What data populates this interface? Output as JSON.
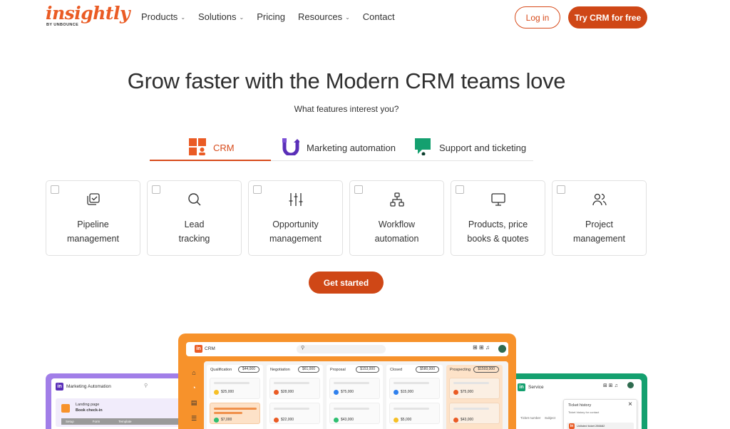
{
  "header": {
    "logo_text": "insightly",
    "logo_sub": "BY UNBOUNCE",
    "nav": [
      {
        "label": "Products",
        "dropdown": true
      },
      {
        "label": "Solutions",
        "dropdown": true
      },
      {
        "label": "Pricing",
        "dropdown": false
      },
      {
        "label": "Resources",
        "dropdown": true
      },
      {
        "label": "Contact",
        "dropdown": false
      }
    ],
    "login_label": "Log in",
    "try_label": "Try CRM for free"
  },
  "hero": {
    "title": "Grow faster with the Modern CRM teams love",
    "subtitle": "What features interest you?"
  },
  "tabs": [
    {
      "label": "CRM",
      "icon": "crm-grid-icon",
      "active": true
    },
    {
      "label": "Marketing automation",
      "icon": "marketing-automation-icon",
      "active": false
    },
    {
      "label": "Support and ticketing",
      "icon": "support-chat-icon",
      "active": false
    }
  ],
  "features": [
    {
      "line1": "Pipeline",
      "line2": "management",
      "icon": "pipeline-check-icon"
    },
    {
      "line1": "Lead",
      "line2": "tracking",
      "icon": "search-icon"
    },
    {
      "line1": "Opportunity",
      "line2": "management",
      "icon": "sliders-icon"
    },
    {
      "line1": "Workflow",
      "line2": "automation",
      "icon": "workflow-icon"
    },
    {
      "line1": "Products, price",
      "line2": "books & quotes",
      "icon": "monitor-icon"
    },
    {
      "line1": "Project",
      "line2": "management",
      "icon": "users-icon"
    }
  ],
  "cta_label": "Get started",
  "colors": {
    "brand": "#ea5b24",
    "button": "#cf4716",
    "mock_orange": "#f7922b",
    "mock_purple": "#a17ee8",
    "mock_green": "#14a06f"
  },
  "mock": {
    "left": {
      "app": "Marketing Automation",
      "line1": "Landing page",
      "line2": "Book check-in",
      "steps": [
        "Setup",
        "Form",
        "Template"
      ]
    },
    "center": {
      "app": "CRM",
      "columns": [
        {
          "title": "Qualification",
          "total": "$44,000",
          "amounts": [
            "$25,000",
            "$7,000"
          ],
          "highlight": false
        },
        {
          "title": "Negotiation",
          "total": "$61,000",
          "amounts": [
            "$28,000",
            "$22,000"
          ],
          "highlight": false
        },
        {
          "title": "Proposal",
          "total": "$153,000",
          "amounts": [
            "$75,000",
            "$43,000"
          ],
          "highlight": false
        },
        {
          "title": "Closed",
          "total": "$580,000",
          "amounts": [
            "$15,000",
            "$5,000"
          ],
          "highlight": false
        },
        {
          "title": "Prospecting",
          "total": "$1503,000",
          "amounts": [
            "$75,000",
            "$43,000"
          ],
          "highlight": true
        }
      ]
    },
    "right": {
      "app": "Service",
      "panel_title": "Ticket history",
      "panel_sub": "Ticket history for contact",
      "col1": "Ticket number",
      "col2": "Subject",
      "row": "Unlisted ticket 286682"
    }
  }
}
